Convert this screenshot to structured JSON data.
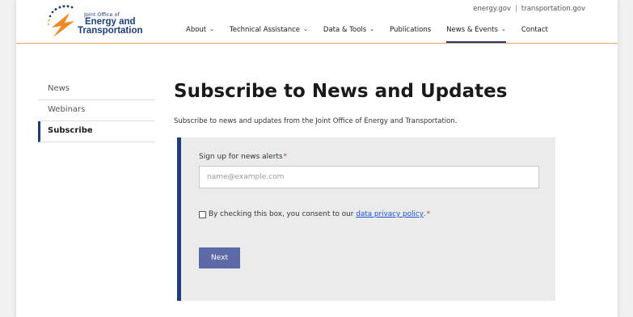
{
  "header": {
    "logo_small": "Joint Office of",
    "logo_line1": "Energy and",
    "logo_line2": "Transportation",
    "ext_links": [
      "energy.gov",
      "transportation.gov"
    ],
    "ext_separator": "|",
    "nav": [
      {
        "label": "About",
        "caret": "⌄"
      },
      {
        "label": "Technical Assistance",
        "caret": "⌄"
      },
      {
        "label": "Data & Tools",
        "caret": "⌄"
      },
      {
        "label": "Publications",
        "caret": ""
      },
      {
        "label": "News & Events",
        "caret": "⌄",
        "active": true
      },
      {
        "label": "Contact",
        "caret": ""
      }
    ]
  },
  "sidebar": {
    "items": [
      {
        "label": "News"
      },
      {
        "label": "Webinars"
      },
      {
        "label": "Subscribe",
        "active": true
      }
    ]
  },
  "main": {
    "title": "Subscribe to News and Updates",
    "subtitle": "Subscribe to news and updates from the Joint Office of Energy and Transportation.",
    "form": {
      "email_label": "Sign up for news alerts",
      "required_mark": "*",
      "email_placeholder": "name@example.com",
      "consent_text": "By checking this box, you consent to our",
      "consent_link": "data privacy policy",
      "consent_suffix": ".",
      "next_label": "Next"
    }
  },
  "colors": {
    "brand_navy": "#1c3d80",
    "header_rule": "#e8a06a",
    "button": "#5c6aa8",
    "link": "#1a4fd6",
    "required": "#c0392b"
  },
  "icons": [
    "logo-bolt-icon",
    "chevron-down-icon",
    "checkbox-icon"
  ]
}
